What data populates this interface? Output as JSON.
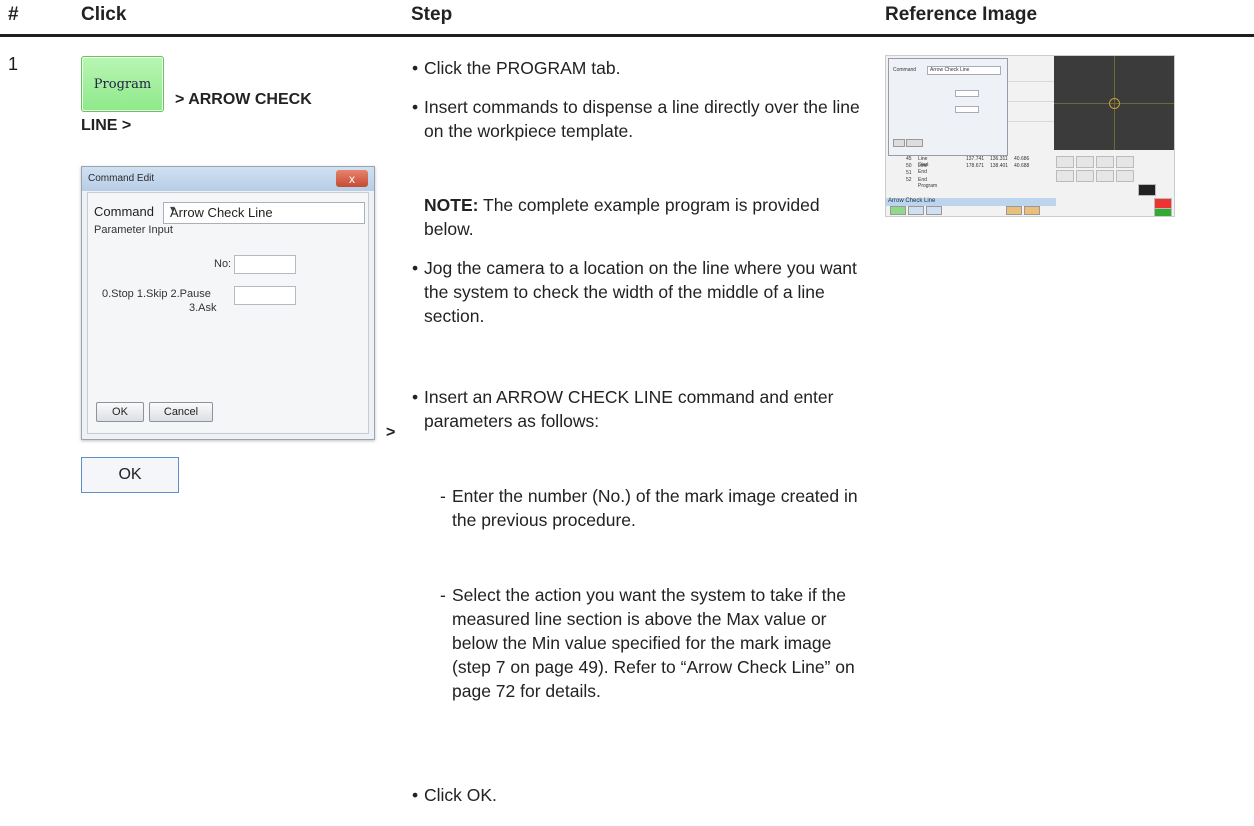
{
  "header": {
    "num": "#",
    "click": "Click",
    "step": "Step",
    "reference": "Reference Image"
  },
  "row": {
    "number": "1",
    "program_button": "Program",
    "click_text_1": "> ARROW CHECK",
    "click_text_2": "LINE >",
    "click_arrow": ">",
    "ok_button": "OK"
  },
  "dialog": {
    "title": "Command Edit",
    "close": "x",
    "command_label": "Command",
    "command_value": "Arrow Check Line",
    "parameter_input": "Parameter Input",
    "no_label": "No:",
    "action_label_1": "0.Stop 1.Skip 2.Pause",
    "action_label_2": "3.Ask",
    "ok": "OK",
    "cancel": "Cancel"
  },
  "steps": {
    "s1": "Click the PROGRAM tab.",
    "s2": "Insert commands to dispense a line directly over the line on the workpiece template.",
    "note_label": "NOTE:",
    "note_text": " The complete example program is provided below.",
    "s3": "Jog the camera to a location on the line where you want the system to check the width of the middle of a line section.",
    "s4": "Insert an ARROW CHECK LINE command and enter parameters as follows:",
    "sub1": "Enter the number (No.) of the mark image created in the previous procedure.",
    "sub2": "Select the action you want the system to take if the measured line section is above the Max value or below the Min value specified for the mark image (step 7 on page 49). Refer to “Arrow Check Line” on page 72 for details.",
    "s5": "Click OK."
  },
  "reference": {
    "mini_command": "Command",
    "mini_value": "Arrow Check Line",
    "mini_status": "Arrow Check Line",
    "rows": [
      {
        "a": "45",
        "b": "Line Start",
        "c": "137.741",
        "d": "136.311",
        "e": "40.686"
      },
      {
        "a": "50",
        "b": "Line End",
        "c": "178.671",
        "d": "138.401",
        "e": "40.688"
      },
      {
        "a": "51",
        "b": "",
        "c": "",
        "d": "",
        "e": ""
      },
      {
        "a": "52",
        "b": "End Program",
        "c": "",
        "d": "",
        "e": ""
      }
    ]
  },
  "colors": {
    "program_green": "#9cef96",
    "ok_border": "#5e8fc6",
    "header_rule": "#1e1e1e"
  }
}
